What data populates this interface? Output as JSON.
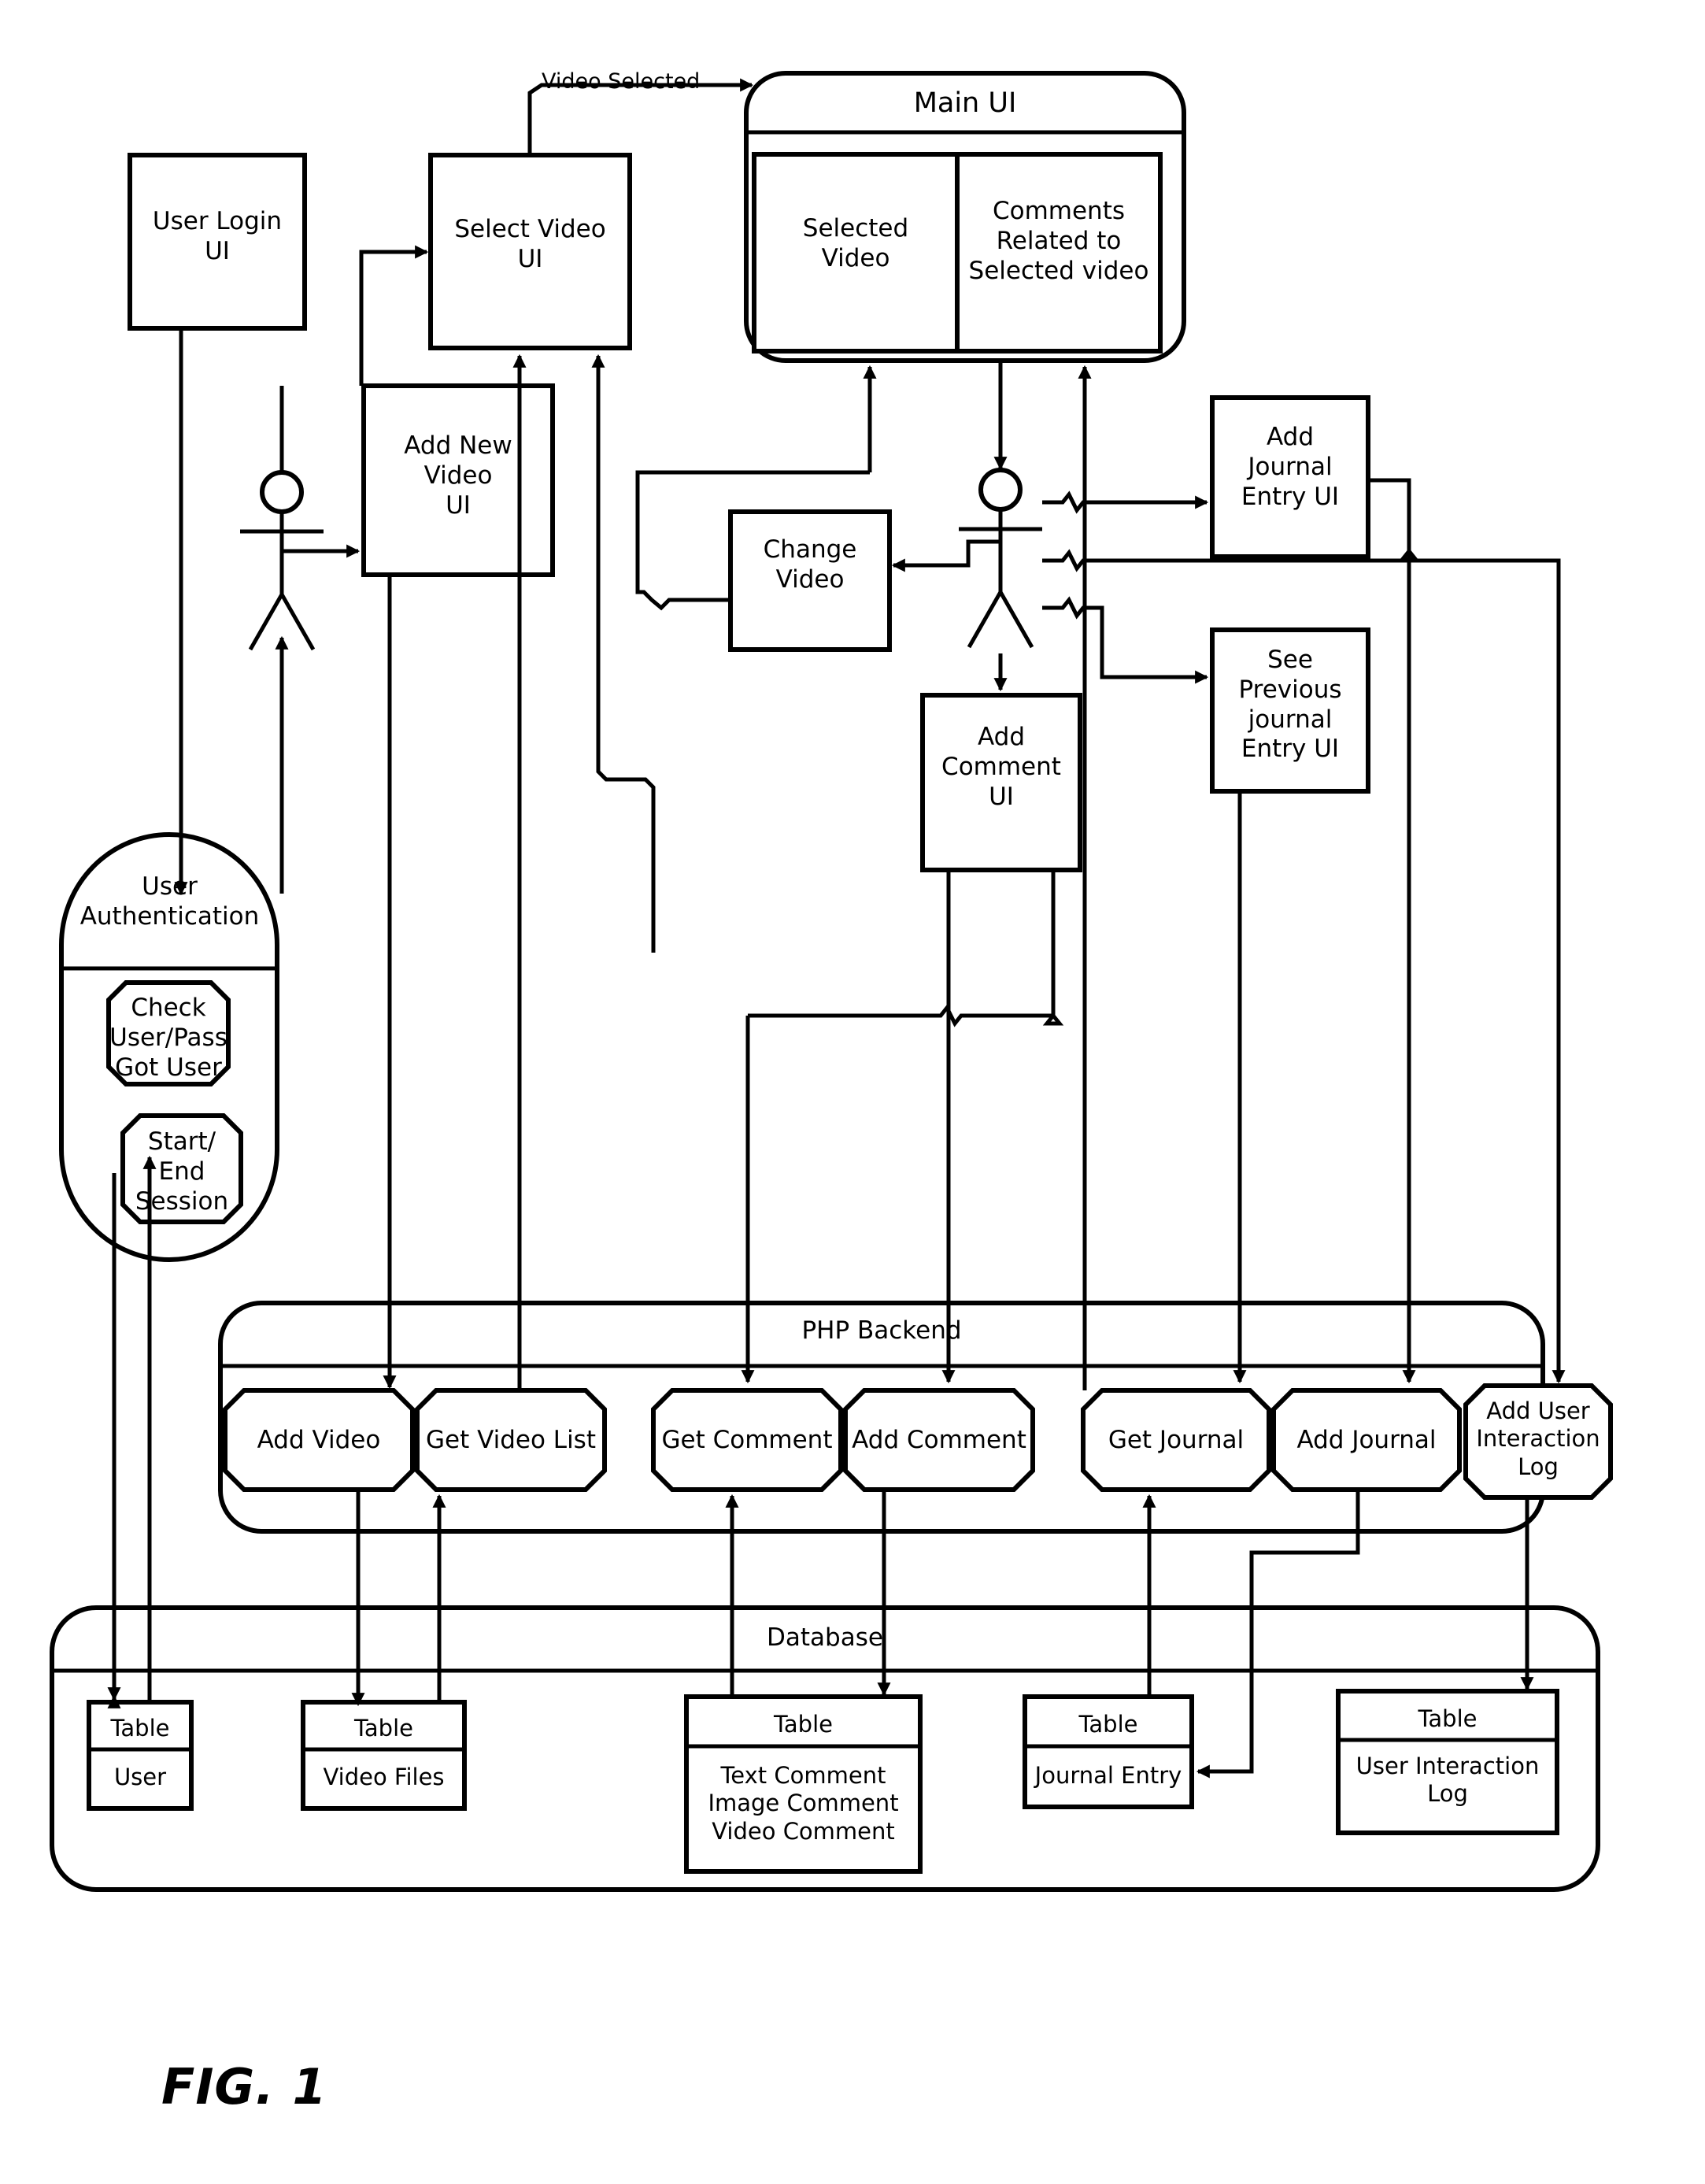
{
  "figure": {
    "caption": "FIG. 1",
    "title": "Video sharing system architecture block diagram"
  },
  "edge_labels": {
    "video_selected": "Video Selected"
  },
  "ui_layer": {
    "boxes": [
      {
        "id": "user-login-ui",
        "label": "User Login\nUI"
      },
      {
        "id": "select-video-ui",
        "label": "Select Video\nUI"
      },
      {
        "id": "add-new-video-ui",
        "label": "Add New\nVideo\nUI"
      },
      {
        "id": "change-video",
        "label": "Change\nVideo"
      },
      {
        "id": "add-comment-ui",
        "label": "Add\nComment\nUI"
      },
      {
        "id": "add-journal-entry-ui",
        "label": "Add\nJournal\nEntry UI"
      },
      {
        "id": "see-previous-journal-entry-ui",
        "label": "See\nPrevious\njournal\nEntry UI"
      }
    ]
  },
  "main_ui": {
    "title": "Main UI",
    "panels": [
      {
        "id": "selected-video-panel",
        "label": "Selected\nVideo"
      },
      {
        "id": "comments-panel",
        "label": "Comments\nRelated to\nSelected video"
      }
    ]
  },
  "authentication": {
    "title": "User\nAuthentication",
    "components": [
      {
        "id": "check-user-pass",
        "label": "Check\nUser/Pass\nGot User"
      },
      {
        "id": "start-end-session",
        "label": "Start/\nEnd\nSession"
      }
    ]
  },
  "backend": {
    "title": "PHP Backend",
    "services": [
      {
        "id": "add-video",
        "label": "Add Video"
      },
      {
        "id": "get-video-list",
        "label": "Get Video List"
      },
      {
        "id": "get-comment",
        "label": "Get Comment"
      },
      {
        "id": "add-comment",
        "label": "Add Comment"
      },
      {
        "id": "get-journal",
        "label": "Get Journal"
      },
      {
        "id": "add-journal",
        "label": "Add Journal"
      },
      {
        "id": "add-user-interaction-log",
        "label": "Add User\nInteraction\nLog"
      }
    ]
  },
  "database": {
    "title": "Database",
    "tables": [
      {
        "id": "table-user",
        "header": "Table",
        "body": "User"
      },
      {
        "id": "table-video-files",
        "header": "Table",
        "body": "Video Files"
      },
      {
        "id": "table-comments",
        "header": "Table",
        "body": "Text Comment\nImage Comment\nVideo Comment"
      },
      {
        "id": "table-journal-entry",
        "header": "Table",
        "body": "Journal Entry"
      },
      {
        "id": "table-user-interaction-log",
        "header": "Table",
        "body": "User Interaction\nLog"
      }
    ]
  },
  "actors": [
    {
      "id": "actor-left",
      "label": ""
    },
    {
      "id": "actor-right",
      "label": ""
    }
  ],
  "colors": {
    "stroke": "#000000",
    "fill": "#ffffff"
  }
}
